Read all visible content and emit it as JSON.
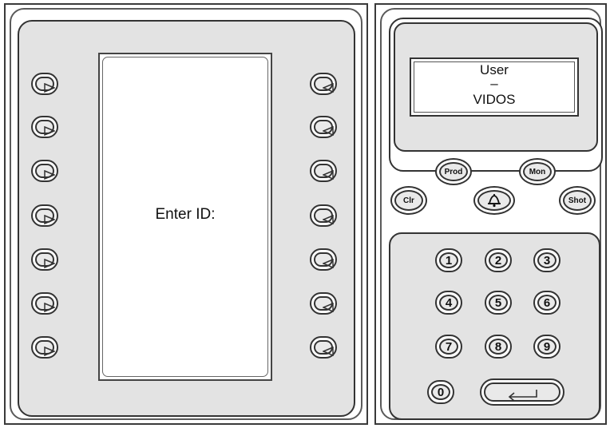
{
  "screen": {
    "prompt": "Enter ID:"
  },
  "softkeys": {
    "left_arrow_icon": "triangle-right-icon",
    "right_arrow_icon": "triangle-left-icon"
  },
  "lcd": {
    "line1": "User",
    "line2": "–",
    "line3": "VIDOS"
  },
  "function_buttons": {
    "prod": "Prod",
    "mon": "Mon",
    "clr": "Clr",
    "bell_icon": "bell-icon",
    "shot": "Shot"
  },
  "keypad": {
    "keys": [
      "1",
      "2",
      "3",
      "4",
      "5",
      "6",
      "7",
      "8",
      "9",
      "0"
    ],
    "enter_icon": "enter-arrow-icon"
  },
  "colors": {
    "panel": "#e3e3e3",
    "key": "#e9e9e9",
    "outline": "#333333"
  }
}
